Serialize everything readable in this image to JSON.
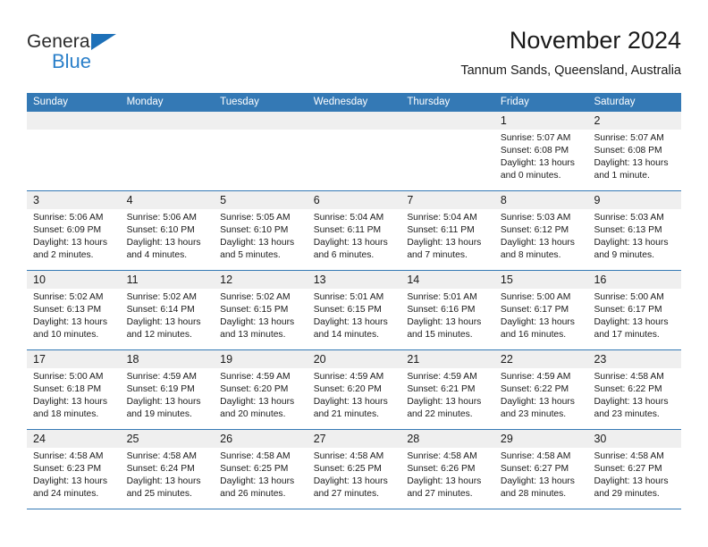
{
  "brand": {
    "name_part1": "General",
    "name_part2": "Blue",
    "triangle_icon": "brand-triangle-icon",
    "accent_color": "#2a7fc9"
  },
  "header": {
    "title": "November 2024",
    "subtitle": "Tannum Sands, Queensland, Australia"
  },
  "colors": {
    "header_blue": "#3479b5",
    "daynum_band": "#efefef",
    "text": "#1a1a1a"
  },
  "weekdays": [
    "Sunday",
    "Monday",
    "Tuesday",
    "Wednesday",
    "Thursday",
    "Friday",
    "Saturday"
  ],
  "weeks": [
    {
      "days": [
        {
          "num": "",
          "sunrise": "",
          "sunset": "",
          "daylight1": "",
          "daylight2": ""
        },
        {
          "num": "",
          "sunrise": "",
          "sunset": "",
          "daylight1": "",
          "daylight2": ""
        },
        {
          "num": "",
          "sunrise": "",
          "sunset": "",
          "daylight1": "",
          "daylight2": ""
        },
        {
          "num": "",
          "sunrise": "",
          "sunset": "",
          "daylight1": "",
          "daylight2": ""
        },
        {
          "num": "",
          "sunrise": "",
          "sunset": "",
          "daylight1": "",
          "daylight2": ""
        },
        {
          "num": "1",
          "sunrise": "Sunrise: 5:07 AM",
          "sunset": "Sunset: 6:08 PM",
          "daylight1": "Daylight: 13 hours",
          "daylight2": "and 0 minutes."
        },
        {
          "num": "2",
          "sunrise": "Sunrise: 5:07 AM",
          "sunset": "Sunset: 6:08 PM",
          "daylight1": "Daylight: 13 hours",
          "daylight2": "and 1 minute."
        }
      ]
    },
    {
      "days": [
        {
          "num": "3",
          "sunrise": "Sunrise: 5:06 AM",
          "sunset": "Sunset: 6:09 PM",
          "daylight1": "Daylight: 13 hours",
          "daylight2": "and 2 minutes."
        },
        {
          "num": "4",
          "sunrise": "Sunrise: 5:06 AM",
          "sunset": "Sunset: 6:10 PM",
          "daylight1": "Daylight: 13 hours",
          "daylight2": "and 4 minutes."
        },
        {
          "num": "5",
          "sunrise": "Sunrise: 5:05 AM",
          "sunset": "Sunset: 6:10 PM",
          "daylight1": "Daylight: 13 hours",
          "daylight2": "and 5 minutes."
        },
        {
          "num": "6",
          "sunrise": "Sunrise: 5:04 AM",
          "sunset": "Sunset: 6:11 PM",
          "daylight1": "Daylight: 13 hours",
          "daylight2": "and 6 minutes."
        },
        {
          "num": "7",
          "sunrise": "Sunrise: 5:04 AM",
          "sunset": "Sunset: 6:11 PM",
          "daylight1": "Daylight: 13 hours",
          "daylight2": "and 7 minutes."
        },
        {
          "num": "8",
          "sunrise": "Sunrise: 5:03 AM",
          "sunset": "Sunset: 6:12 PM",
          "daylight1": "Daylight: 13 hours",
          "daylight2": "and 8 minutes."
        },
        {
          "num": "9",
          "sunrise": "Sunrise: 5:03 AM",
          "sunset": "Sunset: 6:13 PM",
          "daylight1": "Daylight: 13 hours",
          "daylight2": "and 9 minutes."
        }
      ]
    },
    {
      "days": [
        {
          "num": "10",
          "sunrise": "Sunrise: 5:02 AM",
          "sunset": "Sunset: 6:13 PM",
          "daylight1": "Daylight: 13 hours",
          "daylight2": "and 10 minutes."
        },
        {
          "num": "11",
          "sunrise": "Sunrise: 5:02 AM",
          "sunset": "Sunset: 6:14 PM",
          "daylight1": "Daylight: 13 hours",
          "daylight2": "and 12 minutes."
        },
        {
          "num": "12",
          "sunrise": "Sunrise: 5:02 AM",
          "sunset": "Sunset: 6:15 PM",
          "daylight1": "Daylight: 13 hours",
          "daylight2": "and 13 minutes."
        },
        {
          "num": "13",
          "sunrise": "Sunrise: 5:01 AM",
          "sunset": "Sunset: 6:15 PM",
          "daylight1": "Daylight: 13 hours",
          "daylight2": "and 14 minutes."
        },
        {
          "num": "14",
          "sunrise": "Sunrise: 5:01 AM",
          "sunset": "Sunset: 6:16 PM",
          "daylight1": "Daylight: 13 hours",
          "daylight2": "and 15 minutes."
        },
        {
          "num": "15",
          "sunrise": "Sunrise: 5:00 AM",
          "sunset": "Sunset: 6:17 PM",
          "daylight1": "Daylight: 13 hours",
          "daylight2": "and 16 minutes."
        },
        {
          "num": "16",
          "sunrise": "Sunrise: 5:00 AM",
          "sunset": "Sunset: 6:17 PM",
          "daylight1": "Daylight: 13 hours",
          "daylight2": "and 17 minutes."
        }
      ]
    },
    {
      "days": [
        {
          "num": "17",
          "sunrise": "Sunrise: 5:00 AM",
          "sunset": "Sunset: 6:18 PM",
          "daylight1": "Daylight: 13 hours",
          "daylight2": "and 18 minutes."
        },
        {
          "num": "18",
          "sunrise": "Sunrise: 4:59 AM",
          "sunset": "Sunset: 6:19 PM",
          "daylight1": "Daylight: 13 hours",
          "daylight2": "and 19 minutes."
        },
        {
          "num": "19",
          "sunrise": "Sunrise: 4:59 AM",
          "sunset": "Sunset: 6:20 PM",
          "daylight1": "Daylight: 13 hours",
          "daylight2": "and 20 minutes."
        },
        {
          "num": "20",
          "sunrise": "Sunrise: 4:59 AM",
          "sunset": "Sunset: 6:20 PM",
          "daylight1": "Daylight: 13 hours",
          "daylight2": "and 21 minutes."
        },
        {
          "num": "21",
          "sunrise": "Sunrise: 4:59 AM",
          "sunset": "Sunset: 6:21 PM",
          "daylight1": "Daylight: 13 hours",
          "daylight2": "and 22 minutes."
        },
        {
          "num": "22",
          "sunrise": "Sunrise: 4:59 AM",
          "sunset": "Sunset: 6:22 PM",
          "daylight1": "Daylight: 13 hours",
          "daylight2": "and 23 minutes."
        },
        {
          "num": "23",
          "sunrise": "Sunrise: 4:58 AM",
          "sunset": "Sunset: 6:22 PM",
          "daylight1": "Daylight: 13 hours",
          "daylight2": "and 23 minutes."
        }
      ]
    },
    {
      "days": [
        {
          "num": "24",
          "sunrise": "Sunrise: 4:58 AM",
          "sunset": "Sunset: 6:23 PM",
          "daylight1": "Daylight: 13 hours",
          "daylight2": "and 24 minutes."
        },
        {
          "num": "25",
          "sunrise": "Sunrise: 4:58 AM",
          "sunset": "Sunset: 6:24 PM",
          "daylight1": "Daylight: 13 hours",
          "daylight2": "and 25 minutes."
        },
        {
          "num": "26",
          "sunrise": "Sunrise: 4:58 AM",
          "sunset": "Sunset: 6:25 PM",
          "daylight1": "Daylight: 13 hours",
          "daylight2": "and 26 minutes."
        },
        {
          "num": "27",
          "sunrise": "Sunrise: 4:58 AM",
          "sunset": "Sunset: 6:25 PM",
          "daylight1": "Daylight: 13 hours",
          "daylight2": "and 27 minutes."
        },
        {
          "num": "28",
          "sunrise": "Sunrise: 4:58 AM",
          "sunset": "Sunset: 6:26 PM",
          "daylight1": "Daylight: 13 hours",
          "daylight2": "and 27 minutes."
        },
        {
          "num": "29",
          "sunrise": "Sunrise: 4:58 AM",
          "sunset": "Sunset: 6:27 PM",
          "daylight1": "Daylight: 13 hours",
          "daylight2": "and 28 minutes."
        },
        {
          "num": "30",
          "sunrise": "Sunrise: 4:58 AM",
          "sunset": "Sunset: 6:27 PM",
          "daylight1": "Daylight: 13 hours",
          "daylight2": "and 29 minutes."
        }
      ]
    }
  ]
}
